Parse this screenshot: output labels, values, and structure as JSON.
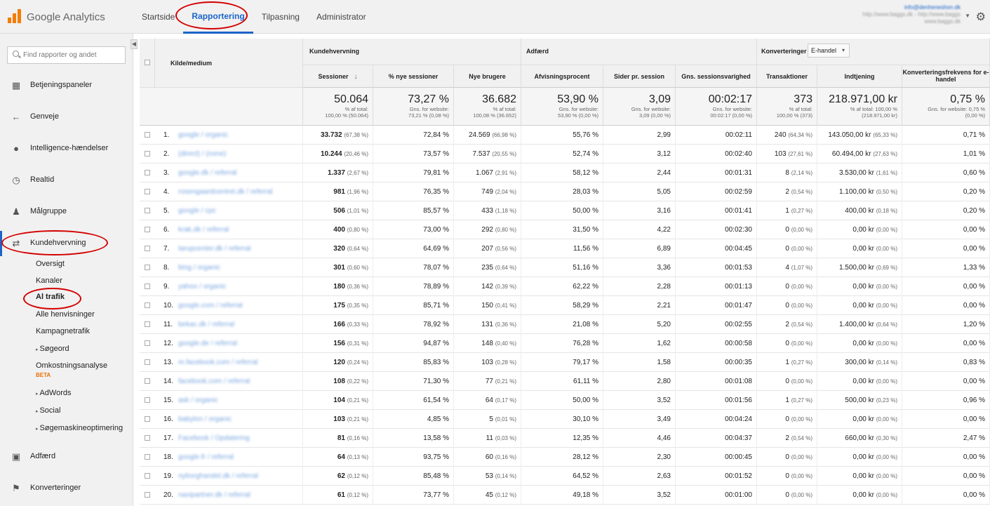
{
  "header": {
    "brand": "Google Analytics",
    "tabs": [
      "Startside",
      "Rapportering",
      "Tilpasning",
      "Administrator"
    ],
    "active_tab": "Rapportering",
    "account_email": "info@denheneshon.dk",
    "account_line1": "http://www.baggs.dk - http://www.baggs",
    "account_line2": "www.baggs.dk"
  },
  "sidebar": {
    "search_placeholder": "Find rapporter og andet",
    "items": [
      {
        "label": "Betjeningspaneler",
        "icon": "grid-icon"
      },
      {
        "label": "Genveje",
        "icon": "shortcut-arrow-icon"
      },
      {
        "label": "Intelligence-hændelser",
        "icon": "lightbulb-icon"
      },
      {
        "label": "Realtid",
        "icon": "clock-icon"
      },
      {
        "label": "Målgruppe",
        "icon": "people-icon"
      },
      {
        "label": "Kundehvervning",
        "icon": "acquisition-icon"
      },
      {
        "label": "Adfærd",
        "icon": "behavior-icon"
      },
      {
        "label": "Konverteringer",
        "icon": "flag-icon"
      }
    ],
    "subitems": [
      "Oversigt",
      "Kanaler",
      "Al trafik",
      "Alle henvisninger",
      "Kampagnetrafik",
      "Søgeord",
      "Omkostningsanalyse",
      "AdWords",
      "Social",
      "Søgemaskineoptimering"
    ],
    "beta_label": "BETA"
  },
  "table": {
    "col_source": "Kilde/medium",
    "group_acquisition": "Kundehvervning",
    "group_behavior": "Adfærd",
    "group_conversions": "Konverteringer",
    "conversion_dropdown": "E-handel",
    "headers": [
      "Sessioner",
      "% nye sessioner",
      "Nye brugere",
      "Afvisningsprocent",
      "Sider pr. session",
      "Gns. sessionsvarighed",
      "Transaktioner",
      "Indtjening",
      "Konverteringsfrekvens for e-handel"
    ],
    "totals": [
      {
        "big": "50.064",
        "s1": "% af total:",
        "s2": "100,00 % (50.064)"
      },
      {
        "big": "73,27 %",
        "s1": "Gns. for website:",
        "s2": "73,21 % (0,08 %)"
      },
      {
        "big": "36.682",
        "s1": "% af total:",
        "s2": "100,08 % (36.652)"
      },
      {
        "big": "53,90 %",
        "s1": "Gns. for website:",
        "s2": "53,90 % (0,00 %)"
      },
      {
        "big": "3,09",
        "s1": "Gns. for website:",
        "s2": "3,09 (0,00 %)"
      },
      {
        "big": "00:02:17",
        "s1": "Gns. for website:",
        "s2": "00:02:17 (0,00 %)"
      },
      {
        "big": "373",
        "s1": "% af total:",
        "s2": "100,00 % (373)"
      },
      {
        "big": "218.971,00 kr",
        "s1": "% af total: 100,00 %",
        "s2": "(218.971,00 kr)"
      },
      {
        "big": "0,75 %",
        "s1": "Gns. for website: 0,75 %",
        "s2": "(0,00 %)"
      }
    ],
    "rows": [
      {
        "n": "1.",
        "src": "google / organic",
        "sess": "33.732",
        "sessp": "(67,38 %)",
        "nyp": "72,84 %",
        "ny": "24.569",
        "nyup": "(66,98 %)",
        "afv": "55,76 %",
        "sider": "2,99",
        "dur": "00:02:11",
        "tr": "240",
        "trp": "(64,34 %)",
        "ind": "143.050,00 kr",
        "indp": "(65,33 %)",
        "konv": "0,71 %"
      },
      {
        "n": "2.",
        "src": "(direct) / (none)",
        "sess": "10.244",
        "sessp": "(20,46 %)",
        "nyp": "73,57 %",
        "ny": "7.537",
        "nyup": "(20,55 %)",
        "afv": "52,74 %",
        "sider": "3,12",
        "dur": "00:02:40",
        "tr": "103",
        "trp": "(27,61 %)",
        "ind": "60.494,00 kr",
        "indp": "(27,63 %)",
        "konv": "1,01 %"
      },
      {
        "n": "3.",
        "src": "google.dk / referral",
        "sess": "1.337",
        "sessp": "(2,67 %)",
        "nyp": "79,81 %",
        "ny": "1.067",
        "nyup": "(2,91 %)",
        "afv": "58,12 %",
        "sider": "2,44",
        "dur": "00:01:31",
        "tr": "8",
        "trp": "(2,14 %)",
        "ind": "3.530,00 kr",
        "indp": "(1,61 %)",
        "konv": "0,60 %"
      },
      {
        "n": "4.",
        "src": "rosengaardcentret.dk / referral",
        "sess": "981",
        "sessp": "(1,96 %)",
        "nyp": "76,35 %",
        "ny": "749",
        "nyup": "(2,04 %)",
        "afv": "28,03 %",
        "sider": "5,05",
        "dur": "00:02:59",
        "tr": "2",
        "trp": "(0,54 %)",
        "ind": "1.100,00 kr",
        "indp": "(0,50 %)",
        "konv": "0,20 %"
      },
      {
        "n": "5.",
        "src": "google / cpc",
        "sess": "506",
        "sessp": "(1,01 %)",
        "nyp": "85,57 %",
        "ny": "433",
        "nyup": "(1,18 %)",
        "afv": "50,00 %",
        "sider": "3,16",
        "dur": "00:01:41",
        "tr": "1",
        "trp": "(0,27 %)",
        "ind": "400,00 kr",
        "indp": "(0,18 %)",
        "konv": "0,20 %"
      },
      {
        "n": "6.",
        "src": "krak.dk / referral",
        "sess": "400",
        "sessp": "(0,80 %)",
        "nyp": "73,00 %",
        "ny": "292",
        "nyup": "(0,80 %)",
        "afv": "31,50 %",
        "sider": "4,22",
        "dur": "00:02:30",
        "tr": "0",
        "trp": "(0,00 %)",
        "ind": "0,00 kr",
        "indp": "(0,00 %)",
        "konv": "0,00 %"
      },
      {
        "n": "7.",
        "src": "tarupcenter.dk / referral",
        "sess": "320",
        "sessp": "(0,64 %)",
        "nyp": "64,69 %",
        "ny": "207",
        "nyup": "(0,56 %)",
        "afv": "11,56 %",
        "sider": "6,89",
        "dur": "00:04:45",
        "tr": "0",
        "trp": "(0,00 %)",
        "ind": "0,00 kr",
        "indp": "(0,00 %)",
        "konv": "0,00 %"
      },
      {
        "n": "8.",
        "src": "bing / organic",
        "sess": "301",
        "sessp": "(0,60 %)",
        "nyp": "78,07 %",
        "ny": "235",
        "nyup": "(0,64 %)",
        "afv": "51,16 %",
        "sider": "3,36",
        "dur": "00:01:53",
        "tr": "4",
        "trp": "(1,07 %)",
        "ind": "1.500,00 kr",
        "indp": "(0,69 %)",
        "konv": "1,33 %"
      },
      {
        "n": "9.",
        "src": "yahoo / organic",
        "sess": "180",
        "sessp": "(0,36 %)",
        "nyp": "78,89 %",
        "ny": "142",
        "nyup": "(0,39 %)",
        "afv": "62,22 %",
        "sider": "2,28",
        "dur": "00:01:13",
        "tr": "0",
        "trp": "(0,00 %)",
        "ind": "0,00 kr",
        "indp": "(0,00 %)",
        "konv": "0,00 %"
      },
      {
        "n": "10.",
        "src": "google.com / referral",
        "sess": "175",
        "sessp": "(0,35 %)",
        "nyp": "85,71 %",
        "ny": "150",
        "nyup": "(0,41 %)",
        "afv": "58,29 %",
        "sider": "2,21",
        "dur": "00:01:47",
        "tr": "0",
        "trp": "(0,00 %)",
        "ind": "0,00 kr",
        "indp": "(0,00 %)",
        "konv": "0,00 %"
      },
      {
        "n": "11.",
        "src": "bekac.dk / referral",
        "sess": "166",
        "sessp": "(0,33 %)",
        "nyp": "78,92 %",
        "ny": "131",
        "nyup": "(0,36 %)",
        "afv": "21,08 %",
        "sider": "5,20",
        "dur": "00:02:55",
        "tr": "2",
        "trp": "(0,54 %)",
        "ind": "1.400,00 kr",
        "indp": "(0,64 %)",
        "konv": "1,20 %"
      },
      {
        "n": "12.",
        "src": "google.de / referral",
        "sess": "156",
        "sessp": "(0,31 %)",
        "nyp": "94,87 %",
        "ny": "148",
        "nyup": "(0,40 %)",
        "afv": "76,28 %",
        "sider": "1,62",
        "dur": "00:00:58",
        "tr": "0",
        "trp": "(0,00 %)",
        "ind": "0,00 kr",
        "indp": "(0,00 %)",
        "konv": "0,00 %"
      },
      {
        "n": "13.",
        "src": "m.facebook.com / referral",
        "sess": "120",
        "sessp": "(0,24 %)",
        "nyp": "85,83 %",
        "ny": "103",
        "nyup": "(0,28 %)",
        "afv": "79,17 %",
        "sider": "1,58",
        "dur": "00:00:35",
        "tr": "1",
        "trp": "(0,27 %)",
        "ind": "300,00 kr",
        "indp": "(0,14 %)",
        "konv": "0,83 %"
      },
      {
        "n": "14.",
        "src": "facebook.com / referral",
        "sess": "108",
        "sessp": "(0,22 %)",
        "nyp": "71,30 %",
        "ny": "77",
        "nyup": "(0,21 %)",
        "afv": "61,11 %",
        "sider": "2,80",
        "dur": "00:01:08",
        "tr": "0",
        "trp": "(0,00 %)",
        "ind": "0,00 kr",
        "indp": "(0,00 %)",
        "konv": "0,00 %"
      },
      {
        "n": "15.",
        "src": "ask / organic",
        "sess": "104",
        "sessp": "(0,21 %)",
        "nyp": "61,54 %",
        "ny": "64",
        "nyup": "(0,17 %)",
        "afv": "50,00 %",
        "sider": "3,52",
        "dur": "00:01:56",
        "tr": "1",
        "trp": "(0,27 %)",
        "ind": "500,00 kr",
        "indp": "(0,23 %)",
        "konv": "0,96 %"
      },
      {
        "n": "16.",
        "src": "babylon / organic",
        "sess": "103",
        "sessp": "(0,21 %)",
        "nyp": "4,85 %",
        "ny": "5",
        "nyup": "(0,01 %)",
        "afv": "30,10 %",
        "sider": "3,49",
        "dur": "00:04:24",
        "tr": "0",
        "trp": "(0,00 %)",
        "ind": "0,00 kr",
        "indp": "(0,00 %)",
        "konv": "0,00 %"
      },
      {
        "n": "17.",
        "src": "Facebook / Opdatering",
        "sess": "81",
        "sessp": "(0,16 %)",
        "nyp": "13,58 %",
        "ny": "11",
        "nyup": "(0,03 %)",
        "afv": "12,35 %",
        "sider": "4,46",
        "dur": "00:04:37",
        "tr": "2",
        "trp": "(0,54 %)",
        "ind": "660,00 kr",
        "indp": "(0,30 %)",
        "konv": "2,47 %"
      },
      {
        "n": "18.",
        "src": "google.fr / referral",
        "sess": "64",
        "sessp": "(0,13 %)",
        "nyp": "93,75 %",
        "ny": "60",
        "nyup": "(0,16 %)",
        "afv": "28,12 %",
        "sider": "2,30",
        "dur": "00:00:45",
        "tr": "0",
        "trp": "(0,00 %)",
        "ind": "0,00 kr",
        "indp": "(0,00 %)",
        "konv": "0,00 %"
      },
      {
        "n": "19.",
        "src": "nyborghandel.dk / referral",
        "sess": "62",
        "sessp": "(0,12 %)",
        "nyp": "85,48 %",
        "ny": "53",
        "nyup": "(0,14 %)",
        "afv": "64,52 %",
        "sider": "2,63",
        "dur": "00:01:52",
        "tr": "0",
        "trp": "(0,00 %)",
        "ind": "0,00 kr",
        "indp": "(0,00 %)",
        "konv": "0,00 %"
      },
      {
        "n": "20.",
        "src": "navipartner.dk / referral",
        "sess": "61",
        "sessp": "(0,12 %)",
        "nyp": "73,77 %",
        "ny": "45",
        "nyup": "(0,12 %)",
        "afv": "49,18 %",
        "sider": "3,52",
        "dur": "00:01:00",
        "tr": "0",
        "trp": "(0,00 %)",
        "ind": "0,00 kr",
        "indp": "(0,00 %)",
        "konv": "0,00 %"
      }
    ]
  },
  "colors": {
    "accent": "#1b64c8",
    "logo": "#f57c00",
    "annotation": "#d40000"
  }
}
